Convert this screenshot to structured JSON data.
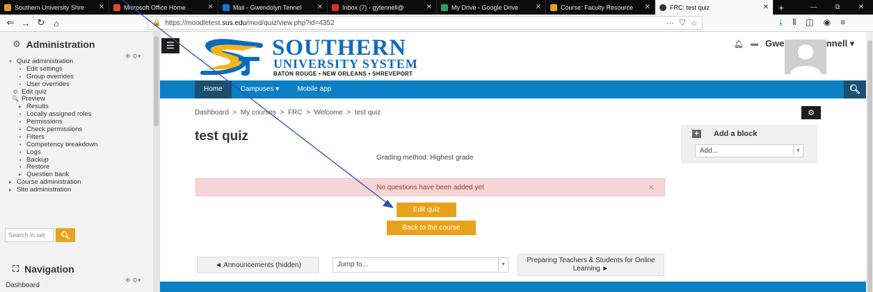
{
  "tabs": [
    {
      "label": "Southern University Shre",
      "favicon_color": "#d9a21b",
      "active": false
    },
    {
      "label": "Microsoft Office Home",
      "favicon_color": "#e74c1c",
      "active": false
    },
    {
      "label": "Mail - Gwendolyn Tennel",
      "favicon_color": "#0f78d4",
      "active": false
    },
    {
      "label": "Inbox (7) - gytennell@",
      "favicon_color": "#d93025",
      "active": false
    },
    {
      "label": "My Drive - Google Drive",
      "favicon_color": "#1fa463",
      "active": false
    },
    {
      "label": "Course: Faculty Resource",
      "favicon_color": "#e8a21a",
      "active": false
    },
    {
      "label": "FRC: test quiz",
      "favicon_color": "#ffffff",
      "active": true
    }
  ],
  "browser": {
    "url_prefix": "https://moodletest.",
    "url_domain": "sus.edu",
    "url_path": "/mod/quiz/view.php?id=4352"
  },
  "drawer": {
    "admin_title": "Administration",
    "admin_items": [
      {
        "mark": "▾",
        "label": "Quiz administration",
        "indent": 0
      },
      {
        "mark": "▪",
        "label": "Edit settings",
        "indent": 1
      },
      {
        "mark": "▪",
        "label": "Group overrides",
        "indent": 1
      },
      {
        "mark": "▪",
        "label": "User overrides",
        "indent": 1
      },
      {
        "mark": "⚙",
        "label": "Edit quiz",
        "indent": 0.5
      },
      {
        "mark": "🔍",
        "label": "Preview",
        "indent": 0.5
      },
      {
        "mark": "▸",
        "label": "Results",
        "indent": 1
      },
      {
        "mark": "▪",
        "label": "Locally assigned roles",
        "indent": 1
      },
      {
        "mark": "▪",
        "label": "Permissions",
        "indent": 1
      },
      {
        "mark": "▪",
        "label": "Check permissions",
        "indent": 1
      },
      {
        "mark": "▪",
        "label": "Filters",
        "indent": 1
      },
      {
        "mark": "▪",
        "label": "Competency breakdown",
        "indent": 1
      },
      {
        "mark": "▪",
        "label": "Logs",
        "indent": 1
      },
      {
        "mark": "▪",
        "label": "Backup",
        "indent": 1
      },
      {
        "mark": "▪",
        "label": "Restore",
        "indent": 1
      },
      {
        "mark": "▸",
        "label": "Question bank",
        "indent": 1
      },
      {
        "mark": "▸",
        "label": "Course administration",
        "indent": 0
      },
      {
        "mark": "▸",
        "label": "Site administration",
        "indent": 0
      }
    ],
    "search_placeholder": "Search in set",
    "nav_title": "Navigation",
    "nav_first": "Dashboard"
  },
  "header": {
    "logo_title": "SOUTHERN",
    "logo_sub": "UNIVERSITY SYSTEM",
    "logo_cities": "BATON ROUGE • NEW ORLEANS • SHREVEPORT",
    "user_name": "Gwendolyn Tennell"
  },
  "menu": {
    "items": [
      "Home",
      "Campuses ▾",
      "Mobile app"
    ]
  },
  "page": {
    "breadcrumb": [
      "Dashboard",
      "My courses",
      "FRC",
      "Welcome",
      "test quiz"
    ],
    "title": "test quiz",
    "grading": "Grading method: Highest grade",
    "alert": "No questions have been added yet",
    "edit_quiz": "Edit quiz",
    "back_course": "Back to the course",
    "prev_activity": "◄ Announcements (hidden)",
    "jump_to": "Jump to...",
    "next_activity": "Preparing Teachers & Students for Online Learning ►"
  },
  "addblock": {
    "title": "Add a block",
    "select_value": "Add..."
  },
  "colors": {
    "accent_blue": "#0a7fc2",
    "button_orange": "#e8a21a",
    "alert_bg": "#f4d6d6"
  }
}
